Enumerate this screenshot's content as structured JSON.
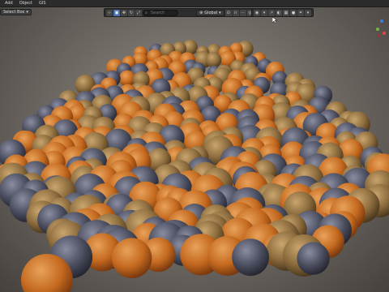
{
  "header": {
    "menu": [
      {
        "label": "Add"
      },
      {
        "label": "Object"
      },
      {
        "label": "GIS"
      }
    ]
  },
  "subheader": {
    "select_mode": "Select Box",
    "transform_orientation": "Global",
    "search_placeholder": "Search"
  },
  "colors": {
    "header_bg": "#2b2b2b",
    "active_tool": "#4a72b0",
    "gizmo_x": "#e04848",
    "gizmo_y": "#6fb83a",
    "gizmo_z": "#3d7de0"
  },
  "icons": [
    "cursor-icon",
    "select-box-icon",
    "move-icon",
    "rotate-icon",
    "scale-icon",
    "search-icon",
    "global-orientation-icon",
    "pivot-icon",
    "snap-icon",
    "proportional-edit-icon",
    "visibility-icon",
    "overlay-icon",
    "filter-icon",
    "navigation-gizmo-icon"
  ]
}
